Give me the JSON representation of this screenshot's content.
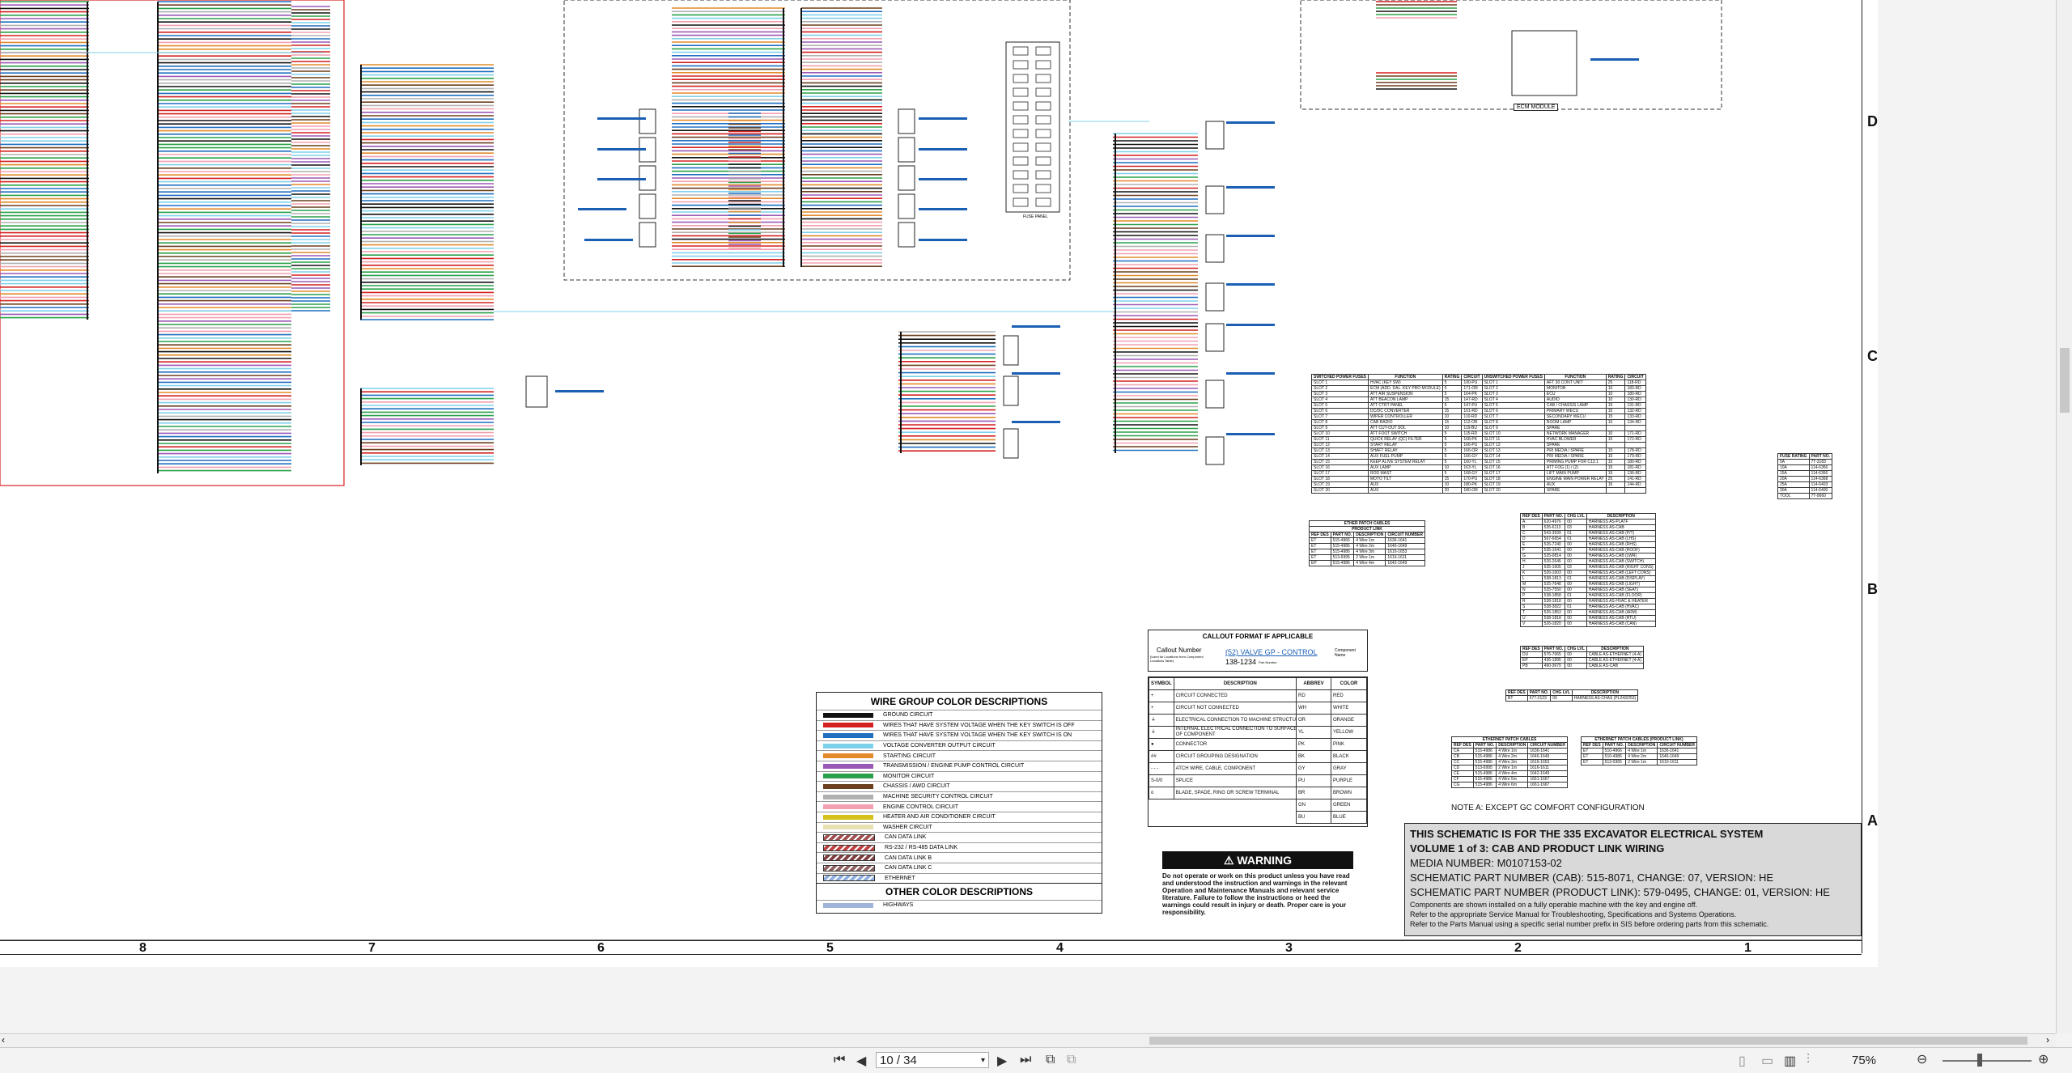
{
  "zones": [
    "D",
    "C",
    "B",
    "A"
  ],
  "columns": [
    "8",
    "7",
    "6",
    "5",
    "4",
    "3",
    "2",
    "1"
  ],
  "fuse_panel_label": "FUSE PANEL",
  "ecm_module_label": "ECM MODULE",
  "fuse_table": {
    "headers": [
      "SWITCHED POWER FUSES",
      "FUNCTION",
      "RATING",
      "CIRCUIT",
      "UNSWITCHED POWER FUSES",
      "FUNCTION",
      "RATING",
      "CIRCUIT"
    ],
    "rows": [
      [
        "SLOT 1",
        "HVAC (KEY SW)",
        "5",
        "190-PU",
        "SLOT 1",
        "AFT 30 CONT UNIT",
        "25",
        "118-RD"
      ],
      [
        "SLOT 2",
        "ECM (ADD. DAL. KEY PRO MODULE)",
        "5",
        "171-OR",
        "SLOT 2",
        "MONITOR",
        "10",
        "183-RD"
      ],
      [
        "SLOT 3",
        "ATT AIR SUSPENSION",
        "5",
        "164-PK",
        "SLOT 3",
        "ECU",
        "10",
        "180-RD"
      ],
      [
        "SLOT 4",
        "ATT BEACON LAMP",
        "15",
        "147-RD",
        "SLOT 4",
        "AUDIO",
        "10",
        "130-RD"
      ],
      [
        "SLOT 5",
        "ATT CTRT PANEL",
        "5",
        "147-PU",
        "SLOT 5",
        "CAB / CHASSIS LAMP",
        "15",
        "131-RD"
      ],
      [
        "SLOT 6",
        "DC/DC CONVERTER",
        "15",
        "101-RD",
        "SLOT 6",
        "PRIMARY WECU",
        "15",
        "132-RD"
      ],
      [
        "SLOT 7",
        "WIPER CONTROLLER",
        "10",
        "110-RD",
        "SLOT 7",
        "SECONDARY WECU",
        "15",
        "133-RD"
      ],
      [
        "SLOT 8",
        "CAB RADIO",
        "15",
        "112-OR",
        "SLOT 8",
        "ROOM LAMP",
        "10",
        "134-RD"
      ],
      [
        "SLOT 9",
        "ATT CUT-OUT SOL",
        "10",
        "119-BU",
        "SLOT 9",
        "SPARE",
        "",
        ""
      ],
      [
        "SLOT 10",
        "ATT FOOT SWITCH",
        "5",
        "115-RD",
        "SLOT 10",
        "NETWORK MANAGER",
        "10",
        "171-RD"
      ],
      [
        "SLOT 11",
        "QUICK RELAY (QC) FILTER",
        "5",
        "168-PK",
        "SLOT 11",
        "HVAC BLOWER",
        "15",
        "172-RD"
      ],
      [
        "SLOT 12",
        "START RELAY",
        "5",
        "166-PU",
        "SLOT 12",
        "SPARE",
        "",
        ""
      ],
      [
        "SLOT 13",
        "SHAFT RELAY",
        "5",
        "166-OR",
        "SLOT 13",
        "PRI MEDIA / SPARE",
        "15",
        "178-RD"
      ],
      [
        "SLOT 14",
        "AUX FUEL PUMP",
        "5",
        "166-GY",
        "SLOT 14",
        "PRI MEDIA / SPARE",
        "15",
        "179-RD"
      ],
      [
        "SLOT 15",
        "KEEP ALIVE SYSTEM RELAY",
        "5",
        "160-YL",
        "SLOT 15",
        "PRIMING PUMP FOR C13.1",
        "15",
        "180-RD"
      ],
      [
        "SLOT 16",
        "AUX LAMP",
        "10",
        "163-YL",
        "SLOT 16",
        "ATT FOG (1) / (2)",
        "15",
        "181-RD"
      ],
      [
        "SLOT 17",
        "ROD MAST",
        "5",
        "168-GY",
        "SLOT 17",
        "LIFT MAIN PUMP",
        "15",
        "136-RD"
      ],
      [
        "SLOT 18",
        "MOTO TILT",
        "15",
        "170-PU",
        "SLOT 18",
        "ENGINE MAIN POWER RELAY",
        "25",
        "141-RD"
      ],
      [
        "SLOT 19",
        "AUX",
        "10",
        "180-PK",
        "SLOT 19",
        "AUX",
        "15",
        "144-RD"
      ],
      [
        "SLOT 20",
        "AUX",
        "20",
        "180-OR",
        "SLOT 20",
        "SPARE",
        "",
        ""
      ]
    ]
  },
  "fuse_rating_table": {
    "headers": [
      "FUSE RATING",
      "PART NO."
    ],
    "rows": [
      [
        "5A",
        "7T-3183"
      ],
      [
        "10A",
        "114-6366"
      ],
      [
        "15A",
        "114-6366"
      ],
      [
        "20A",
        "114-6368"
      ],
      [
        "25A",
        "114-6403"
      ],
      [
        "30A",
        "114-6400"
      ],
      [
        "TOOL",
        "7T-0660"
      ]
    ]
  },
  "ether_patch_table": {
    "title": "ETHER PATCH CABLES",
    "subtitle": "PRODUCT LINK",
    "headers": [
      "REF DES",
      "PART NO.",
      "DESCRIPTION",
      "CIRCUIT NUMBER"
    ],
    "rows": [
      [
        "ET",
        "515-4966",
        "4 Wire 1m",
        "1636-1641"
      ],
      [
        "ET",
        "515-4986",
        "4 Wire 2m",
        "1646-1649"
      ],
      [
        "ET",
        "515-4986",
        "4 Wire 3m",
        "1616-1653"
      ],
      [
        "ET",
        "513-6995",
        "2 Wire 1m",
        "1616-1611"
      ],
      [
        "EP",
        "515-4986",
        "4 Wire 4m",
        "1642-1649"
      ]
    ]
  },
  "harness_table": {
    "headers": [
      "REF DES",
      "PART NO.",
      "CHG LVL",
      "DESCRIPTION"
    ],
    "rows": [
      [
        "A",
        "620-4976",
        "00",
        "HARNESS AS-PLATF"
      ],
      [
        "B",
        "535-6113",
        "03",
        "HARNESS AS-CAB"
      ],
      [
        "C",
        "543-3939",
        "01",
        "HARNESS AS-CAB (P/T)"
      ],
      [
        "D",
        "567-6654",
        "01",
        "HARNESS AS-CAB (LHS)"
      ],
      [
        "E",
        "526-7240",
        "00",
        "HARNESS AS-CAB (RHS)"
      ],
      [
        "F",
        "535-1641",
        "00",
        "HARNESS AS-CAB (ROOF)"
      ],
      [
        "G",
        "535-0814",
        "00",
        "HARNESS AS-CAB (LWR)"
      ],
      [
        "H",
        "526-2645",
        "00",
        "HARNESS AS-CAB (SWITCH)"
      ],
      [
        "J",
        "535-1605",
        "03",
        "HARNESS AS-CAB (RIGHT CONS)"
      ],
      [
        "K",
        "526-1603",
        "00",
        "HARNESS AS-CAB (LEFT CONS)"
      ],
      [
        "L",
        "538-1813",
        "01",
        "HARNESS AS-CAB (DISPLAY)"
      ],
      [
        "M",
        "525-7648",
        "00",
        "HARNESS AS-CAB (LIGHT)"
      ],
      [
        "N",
        "535-7550",
        "00",
        "HARNESS AS-CAB (SEAT)"
      ],
      [
        "P",
        "538-1858",
        "01",
        "HARNESS AS-CAB (FLOOR)"
      ],
      [
        "R",
        "538-1818",
        "00",
        "HARNESS AS-HVAC & HEATER"
      ],
      [
        "S",
        "538-3822",
        "01",
        "HARNESS AS-CAB (HVAC)"
      ],
      [
        "T",
        "526-1853",
        "00",
        "HARNESS AS-CAB (ARM)"
      ],
      [
        "U",
        "538-1818",
        "00",
        "HARNESS AS-CAB (RTU)"
      ],
      [
        "V",
        "526-1820",
        "00",
        "HARNESS AS-CAB (CAN)"
      ]
    ]
  },
  "cable_table": {
    "headers": [
      "REF DES",
      "PART NO.",
      "CHG LVL",
      "DESCRIPTION"
    ],
    "rows": [
      [
        "DU",
        "576-7065",
        "00",
        "CABLE AS-ETHERNET (4-A)"
      ],
      [
        "EP",
        "436-1895",
        "00",
        "CABLE AS-ETHERNET (4-A)"
      ],
      [
        "PB",
        "490-3670",
        "00",
        "CABLE AS-CAB"
      ]
    ]
  },
  "harness_single": {
    "headers": [
      "REF DES",
      "PART NO.",
      "CHG LVL",
      "DESCRIPTION"
    ],
    "rows": [
      [
        "BT",
        "577-2123",
        "00",
        "HARNESS AS-CHAS (PL243/253)"
      ]
    ]
  },
  "ethernet_patch_small": {
    "title": "ETHERNET PATCH CABLES",
    "headers": [
      "REF DES",
      "PART NO.",
      "DESCRIPTION",
      "CIRCUIT NUMBER"
    ],
    "rows": [
      [
        "CA",
        "515-4986",
        "4 Wire 1m",
        "1636-1641"
      ],
      [
        "CB",
        "515-4986",
        "4 Wire 2m",
        "1646-1649"
      ],
      [
        "CC",
        "515-4986",
        "4 Wire 3m",
        "1616-1653"
      ],
      [
        "CD",
        "513-6995",
        "2 Wire 1m",
        "1616-1611"
      ],
      [
        "CE",
        "515-4986",
        "4 Wire 4m",
        "1642-1649"
      ],
      [
        "CF",
        "515-4986",
        "4 Wire 5m",
        "1661-1667"
      ],
      [
        "CG",
        "515-4986",
        "4 Wire 6m",
        "1661-1667"
      ]
    ]
  },
  "ethernet_patch_product": {
    "title": "ETHERNET PATCH CABLES (PRODUCT LINK)",
    "headers": [
      "REF DES",
      "PART NO.",
      "DESCRIPTION",
      "CIRCUIT NUMBER"
    ],
    "rows": [
      [
        "ET",
        "510-4966",
        "4 Wire 1m",
        "1636-1641"
      ],
      [
        "ET",
        "510-4986",
        "4 Wire 2m",
        "1646-1649"
      ],
      [
        "ET",
        "513-0365",
        "2 Wire 1m",
        "1610-1611"
      ]
    ]
  },
  "note": "NOTE A: EXCEPT GC COMFORT CONFIGURATION",
  "callout": {
    "title": "CALLOUT FORMAT IF APPLICABLE",
    "left_label": "Callout Number",
    "left_sub": "(Used for Locations from Component Locations Table)",
    "example": "(52) VALVE GP - CONTROL",
    "part": "138-1234",
    "right_label": "Component Name",
    "part_label": "Part Number"
  },
  "symbols": {
    "headers": [
      "SYMBOL",
      "DESCRIPTION"
    ],
    "rows": [
      [
        "+",
        "CIRCUIT CONNECTED"
      ],
      [
        "+",
        "CIRCUIT NOT CONNECTED"
      ],
      [
        "⏚",
        "ELECTRICAL CONNECTION TO MACHINE STRUCTURE"
      ],
      [
        "⏚",
        "INTERNAL ELECTRICAL CONNECTION TO SURFACE OF COMPONENT"
      ],
      [
        "●",
        "CONNECTOR"
      ],
      [
        "##",
        "CIRCUIT GROUPING DESIGNATION"
      ],
      [
        "- - -",
        "ATCH WIRE, CABLE, COMPONENT"
      ],
      [
        "S-0/0",
        "SPLICE"
      ],
      [
        "o",
        "BLADE, SPADE, RING OR SCREW TERMINAL"
      ]
    ]
  },
  "colors_table": {
    "headers": [
      "ABBREV",
      "COLOR"
    ],
    "rows": [
      [
        "RD",
        "RED"
      ],
      [
        "WH",
        "WHITE"
      ],
      [
        "OR",
        "ORANGE"
      ],
      [
        "YL",
        "YELLOW"
      ],
      [
        "PK",
        "PINK"
      ],
      [
        "BK",
        "BLACK"
      ],
      [
        "GY",
        "GRAY"
      ],
      [
        "PU",
        "PURPLE"
      ],
      [
        "BR",
        "BROWN"
      ],
      [
        "GN",
        "GREEN"
      ],
      [
        "BU",
        "BLUE"
      ]
    ]
  },
  "legend": {
    "title": "WIRE GROUP COLOR DESCRIPTIONS",
    "items": [
      {
        "label": "GROUND CIRCUIT",
        "color": "#111111"
      },
      {
        "label": "WIRES THAT HAVE SYSTEM VOLTAGE WHEN THE KEY SWITCH IS OFF",
        "color": "#d42020"
      },
      {
        "label": "WIRES THAT HAVE SYSTEM VOLTAGE WHEN THE KEY SWITCH IS ON",
        "color": "#1f6fbf"
      },
      {
        "label": "VOLTAGE CONVERTER OUTPUT CIRCUIT",
        "color": "#7fd0ea"
      },
      {
        "label": "STARTING CIRCUIT",
        "color": "#e38a2a"
      },
      {
        "label": "TRANSMISSION / ENGINE PUMP CONTROL CIRCUIT",
        "color": "#9b59b6"
      },
      {
        "label": "MONITOR CIRCUIT",
        "color": "#2aa04a"
      },
      {
        "label": "CHASSIS / AWD CIRCUIT",
        "color": "#6b3f1f"
      },
      {
        "label": "MACHINE SECURITY CONTROL CIRCUIT",
        "color": "#b0b0b0"
      },
      {
        "label": "ENGINE CONTROL CIRCUIT",
        "color": "#f2a0b0"
      },
      {
        "label": "HEATER AND AIR CONDITIONER CIRCUIT",
        "color": "#d4c21a"
      },
      {
        "label": "WASHER CIRCUIT",
        "color": "#e8e0b0"
      },
      {
        "label": "CAN DATA LINK",
        "color": "#a05050"
      },
      {
        "label": "RS-232 / RS-485 DATA LINK",
        "color": "#c04040"
      },
      {
        "label": "CAN DATA LINK B",
        "color": "#804040"
      },
      {
        "label": "CAN DATA LINK C",
        "color": "#906060"
      },
      {
        "label": "ETHERNET",
        "color": "#8fb0e0"
      }
    ],
    "other_title": "OTHER COLOR DESCRIPTIONS",
    "other_items": [
      {
        "label": "HIGHWAYS",
        "color": "#9fb4d8"
      }
    ]
  },
  "warning": {
    "title": "WARNING",
    "text": "Do not operate or work on this product unless you have read and understood the instruction and warnings in the relevant Operation and Maintenance Manuals and relevant service literature. Failure to follow the instructions or heed the warnings could result in injury or death. Proper care is your responsibility."
  },
  "title_block": {
    "line1": "THIS SCHEMATIC IS FOR THE 335 EXCAVATOR ELECTRICAL SYSTEM",
    "line2": "VOLUME 1 of 3: CAB AND PRODUCT LINK WIRING",
    "line3": "MEDIA NUMBER: M0107153-02",
    "line4": "SCHEMATIC PART NUMBER (CAB): 515-8071, CHANGE: 07, VERSION: HE",
    "line5": "SCHEMATIC PART NUMBER (PRODUCT LINK): 579-0495, CHANGE: 01, VERSION: HE",
    "line6": "Components are shown installed on a fully operable machine with the key and engine off.",
    "line7": "Refer to the appropriate Service Manual for Troubleshooting, Specifications and Systems Operations.",
    "line8": "Refer to the Parts Manual using a specific serial number prefix in SIS before ordering parts from this schematic."
  },
  "viewer": {
    "page_field": "10 / 34",
    "zoom": "75%"
  }
}
